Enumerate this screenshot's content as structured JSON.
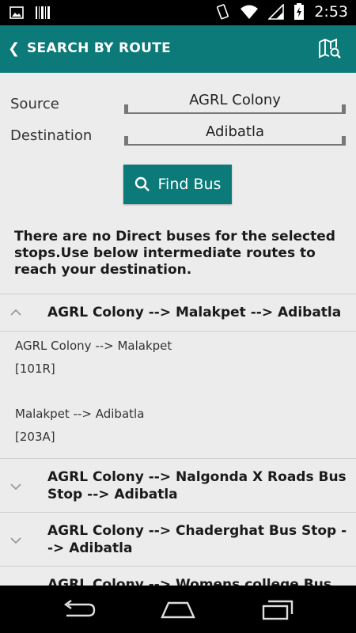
{
  "status_bar": {
    "time": "2:53"
  },
  "app_bar": {
    "title": "SEARCH BY ROUTE"
  },
  "form": {
    "source_label": "Source",
    "source_value": "AGRL Colony",
    "destination_label": "Destination",
    "destination_value": "Adibatla",
    "find_button_label": "Find Bus"
  },
  "notice": "There are no Direct buses for the selected stops.Use below intermediate routes to reach your destination.",
  "routes": [
    {
      "title": "AGRL Colony --> Malakpet --> Adibatla",
      "expanded": true,
      "legs": [
        {
          "path": "AGRL Colony --> Malakpet",
          "buses": "[101R]"
        },
        {
          "path": "Malakpet --> Adibatla",
          "buses": "[203A]"
        }
      ]
    },
    {
      "title": "AGRL Colony --> Nalgonda X Roads Bus Stop --> Adibatla",
      "expanded": false
    },
    {
      "title": "AGRL Colony --> Chaderghat Bus Stop --> Adibatla",
      "expanded": false
    },
    {
      "title": "AGRL Colony --> Womens college Bus",
      "expanded": false
    }
  ],
  "colors": {
    "accent": "#0b7a78",
    "background": "#ececec"
  }
}
